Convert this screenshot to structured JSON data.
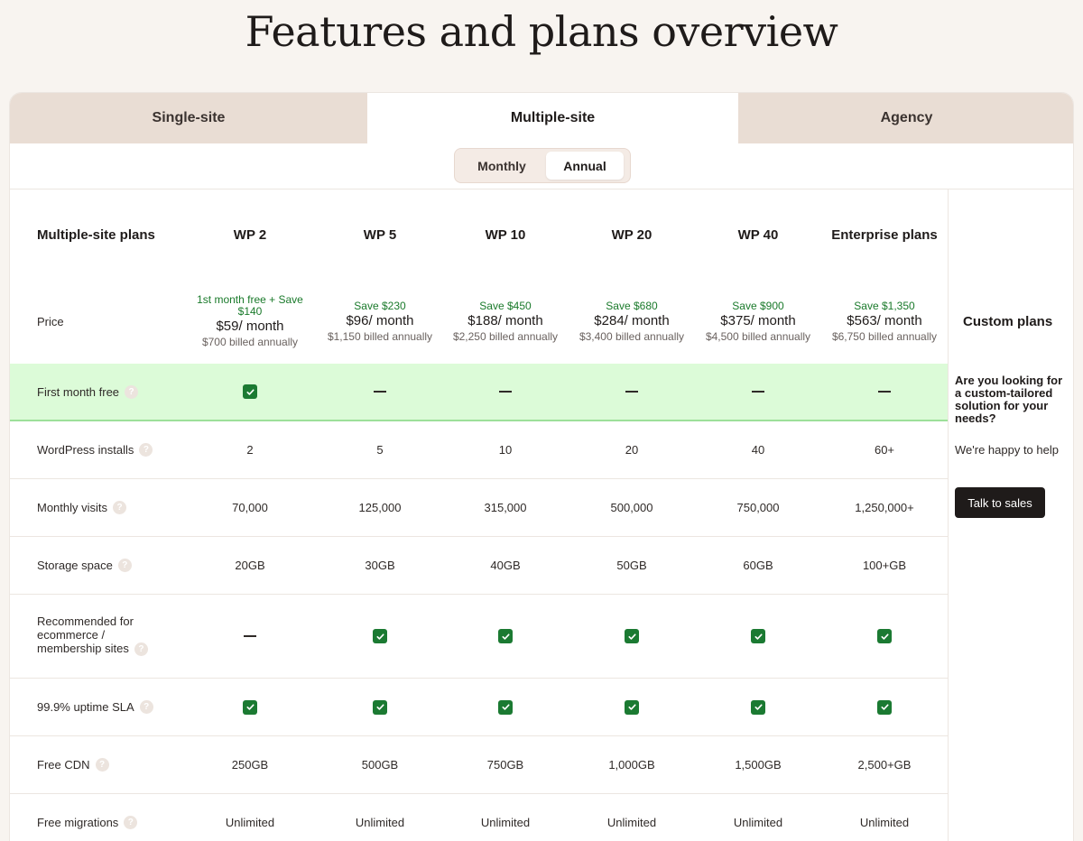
{
  "title": "Features and plans overview",
  "tabs": [
    "Single-site",
    "Multiple-site",
    "Agency"
  ],
  "billing_toggle": {
    "monthly": "Monthly",
    "annual": "Annual",
    "selected": "Annual"
  },
  "table": {
    "header_label": "Multiple-site plans",
    "plans": [
      "WP 2",
      "WP 5",
      "WP 10",
      "WP 20",
      "WP 40",
      "Enterprise plans"
    ],
    "price_label": "Price",
    "prices": [
      {
        "save": "1st month free + Save $140",
        "amount": "$59/ month",
        "billed": "$700 billed annually"
      },
      {
        "save": "Save $230",
        "amount": "$96/ month",
        "billed": "$1,150 billed annually"
      },
      {
        "save": "Save $450",
        "amount": "$188/ month",
        "billed": "$2,250 billed annually"
      },
      {
        "save": "Save $680",
        "amount": "$284/ month",
        "billed": "$3,400 billed annually"
      },
      {
        "save": "Save $900",
        "amount": "$375/ month",
        "billed": "$4,500 billed annually"
      },
      {
        "save": "Save $1,350",
        "amount": "$563/ month",
        "billed": "$6,750 billed annually"
      }
    ],
    "rows": [
      {
        "label": "First month free",
        "values": [
          "check",
          "dash",
          "dash",
          "dash",
          "dash",
          "dash"
        ]
      },
      {
        "label": "WordPress installs",
        "values": [
          "2",
          "5",
          "10",
          "20",
          "40",
          "60+"
        ]
      },
      {
        "label": "Monthly visits",
        "values": [
          "70,000",
          "125,000",
          "315,000",
          "500,000",
          "750,000",
          "1,250,000+"
        ]
      },
      {
        "label": "Storage space",
        "values": [
          "20GB",
          "30GB",
          "40GB",
          "50GB",
          "60GB",
          "100+GB"
        ]
      },
      {
        "label": "Recommended for ecommerce / membership sites",
        "values": [
          "dash",
          "check",
          "check",
          "check",
          "check",
          "check"
        ]
      },
      {
        "label": "99.9% uptime SLA",
        "values": [
          "check",
          "check",
          "check",
          "check",
          "check",
          "check"
        ]
      },
      {
        "label": "Free CDN",
        "values": [
          "250GB",
          "500GB",
          "750GB",
          "1,000GB",
          "1,500GB",
          "2,500+GB"
        ]
      },
      {
        "label": "Free migrations",
        "values": [
          "Unlimited",
          "Unlimited",
          "Unlimited",
          "Unlimited",
          "Unlimited",
          "Unlimited"
        ]
      }
    ]
  },
  "custom": {
    "heading": "Custom plans",
    "question": "Are you looking for a custom-tailored solution for your needs?",
    "help": "We're happy to help",
    "button": "Talk to sales"
  },
  "colors": {
    "accent_green": "#1b7a32",
    "highlight_row": "#dcfbd8",
    "tab_bg": "#e9ddd4",
    "button_dark": "#1f1b1a"
  }
}
